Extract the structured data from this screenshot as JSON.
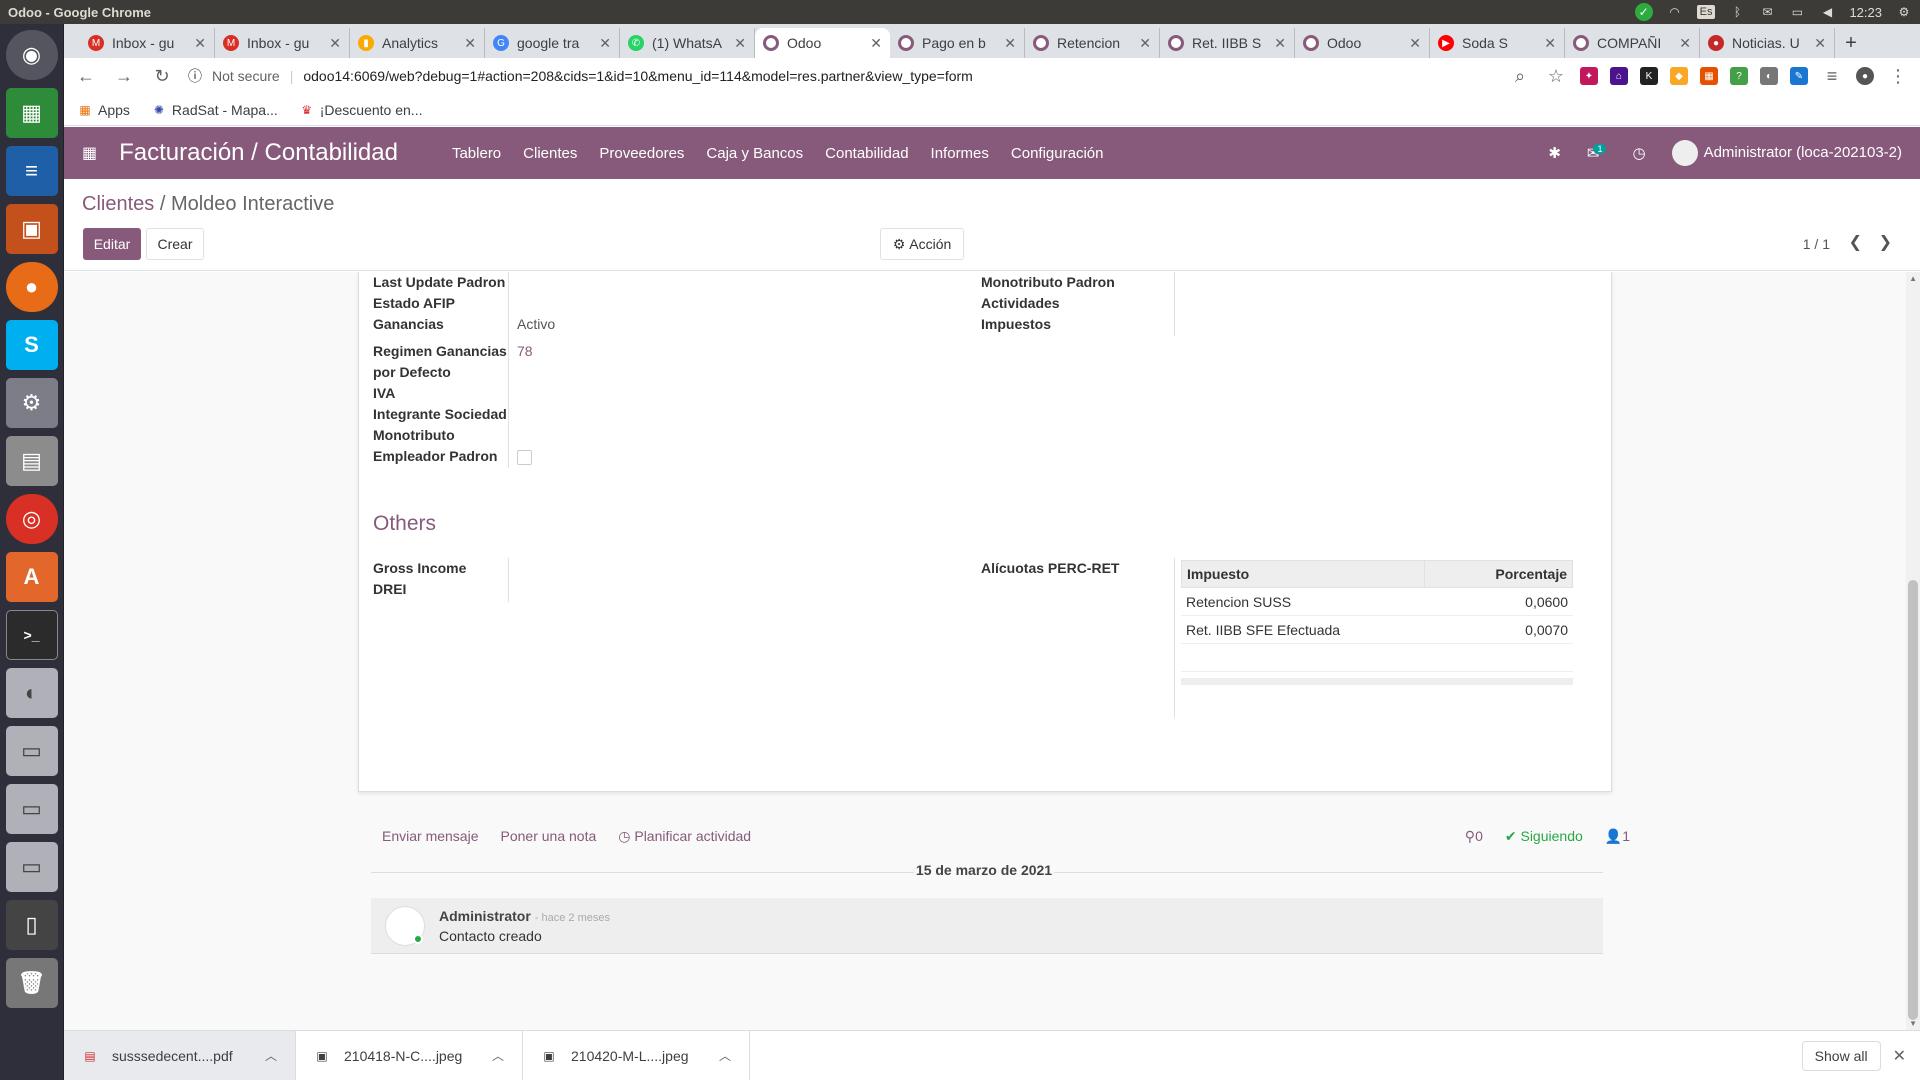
{
  "os": {
    "window_title": "Odoo - Google Chrome",
    "keyboard": "Es",
    "clock": "12:23"
  },
  "launcher": {
    "items": [
      "dash-icon",
      "spreadsheet-icon",
      "writer-icon",
      "impress-icon",
      "firefox-icon",
      "skype-icon",
      "settings-icon",
      "files-icon",
      "chrome-icon",
      "store-icon",
      "terminal-icon",
      "disk-icon",
      "disk-icon",
      "disk-icon",
      "disk-icon",
      "phone-icon",
      "trash-icon"
    ]
  },
  "browser": {
    "tabs": [
      {
        "title": "Inbox - gu",
        "color": "#d93025"
      },
      {
        "title": "Inbox - gu",
        "color": "#d93025"
      },
      {
        "title": "Analytics",
        "color": "#f9ab00"
      },
      {
        "title": "google tra",
        "color": "#4285f4"
      },
      {
        "title": "(1) WhatsA",
        "color": "#25d366"
      },
      {
        "title": "Odoo",
        "color": "#875a7b",
        "active": true
      },
      {
        "title": "Pago en b",
        "color": "#875a7b"
      },
      {
        "title": "Retencion",
        "color": "#875a7b"
      },
      {
        "title": "Ret. IIBB S",
        "color": "#875a7b"
      },
      {
        "title": "Odoo",
        "color": "#875a7b"
      },
      {
        "title": "Soda S",
        "color": "#ff0000"
      },
      {
        "title": "COMPAÑI",
        "color": "#875a7b"
      },
      {
        "title": "Noticias. U",
        "color": "#c62828"
      }
    ],
    "not_secure": "Not secure",
    "url": "odoo14:6069/web?debug=1#action=208&cids=1&id=10&menu_id=114&model=res.partner&view_type=form",
    "bookmarks": [
      {
        "label": "Apps"
      },
      {
        "label": "RadSat - Mapa..."
      },
      {
        "label": "¡Descuento en..."
      }
    ]
  },
  "odoo": {
    "brand": "Facturación / Contabilidad",
    "menu": [
      "Tablero",
      "Clientes",
      "Proveedores",
      "Caja y Bancos",
      "Contabilidad",
      "Informes",
      "Configuración"
    ],
    "messages_badge": "1",
    "user": "Administrator (loca-202103-2)"
  },
  "control": {
    "breadcrumb_parent": "Clientes",
    "breadcrumb_sep": "/",
    "breadcrumb_current": "Moldeo Interactive",
    "edit": "Editar",
    "create": "Crear",
    "action": "Acción",
    "pager": "1 / 1"
  },
  "form": {
    "left_labels": {
      "last_update": "Last Update Padron",
      "estado_afip": "Estado AFIP",
      "ganancias": "Ganancias",
      "regimen": "Regimen Ganancias por Defecto",
      "iva": "IVA",
      "integrante": "Integrante Sociedad",
      "monotributo": "Monotributo",
      "empleador": "Empleador Padron"
    },
    "values": {
      "ganancias": "Activo",
      "regimen": "78"
    },
    "right_labels": {
      "monotributo_padron": "Monotributo Padron",
      "actividades": "Actividades",
      "impuestos": "Impuestos"
    },
    "others_title": "Others",
    "others_labels": {
      "gross_income": "Gross Income",
      "drei": "DREI",
      "alicuotas": "Alícuotas PERC-RET"
    },
    "tax_table": {
      "headers": [
        "Impuesto",
        "Porcentaje"
      ],
      "rows": [
        {
          "tax": "Retencion SUSS",
          "pct": "0,0600"
        },
        {
          "tax": "Ret. IIBB SFE Efectuada",
          "pct": "0,0070"
        }
      ]
    }
  },
  "chatter": {
    "send_message": "Enviar mensaje",
    "log_note": "Poner una nota",
    "schedule": "Planificar actividad",
    "attachments": "0",
    "following": "Siguiendo",
    "followers": "1",
    "date": "15 de marzo de 2021",
    "message": {
      "author": "Administrator",
      "time": "- hace 2 meses",
      "body": "Contacto creado"
    }
  },
  "downloads": {
    "items": [
      "susssedecent....pdf",
      "210418-N-C....jpeg",
      "210420-M-L....jpeg"
    ],
    "show_all": "Show all"
  }
}
